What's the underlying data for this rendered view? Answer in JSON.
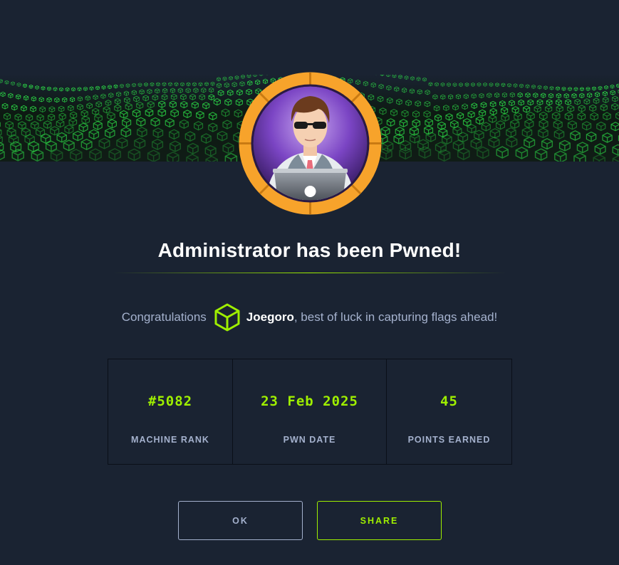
{
  "modal": {
    "title": "Administrator has been Pwned!",
    "congrats": {
      "prefix": "Congratulations",
      "username": "Joegoro",
      "suffix": ", best of luck in capturing flags ahead!"
    },
    "stats": [
      {
        "value": "#5082",
        "label": "MACHINE RANK"
      },
      {
        "value": "23 Feb 2025",
        "label": "PWN DATE"
      },
      {
        "value": "45",
        "label": "POINTS EARNED"
      }
    ],
    "buttons": {
      "ok_label": "OK",
      "share_label": "SHARE"
    }
  },
  "icons": {
    "banner": "green-cube-wave-banner",
    "avatar": "machine-avatar-administrator",
    "user": "cube-icon"
  },
  "colors": {
    "accent": "#9fef00",
    "background": "#1a2332",
    "text_muted": "#a4b1cd",
    "avatar_ring": "#f7a32b"
  }
}
